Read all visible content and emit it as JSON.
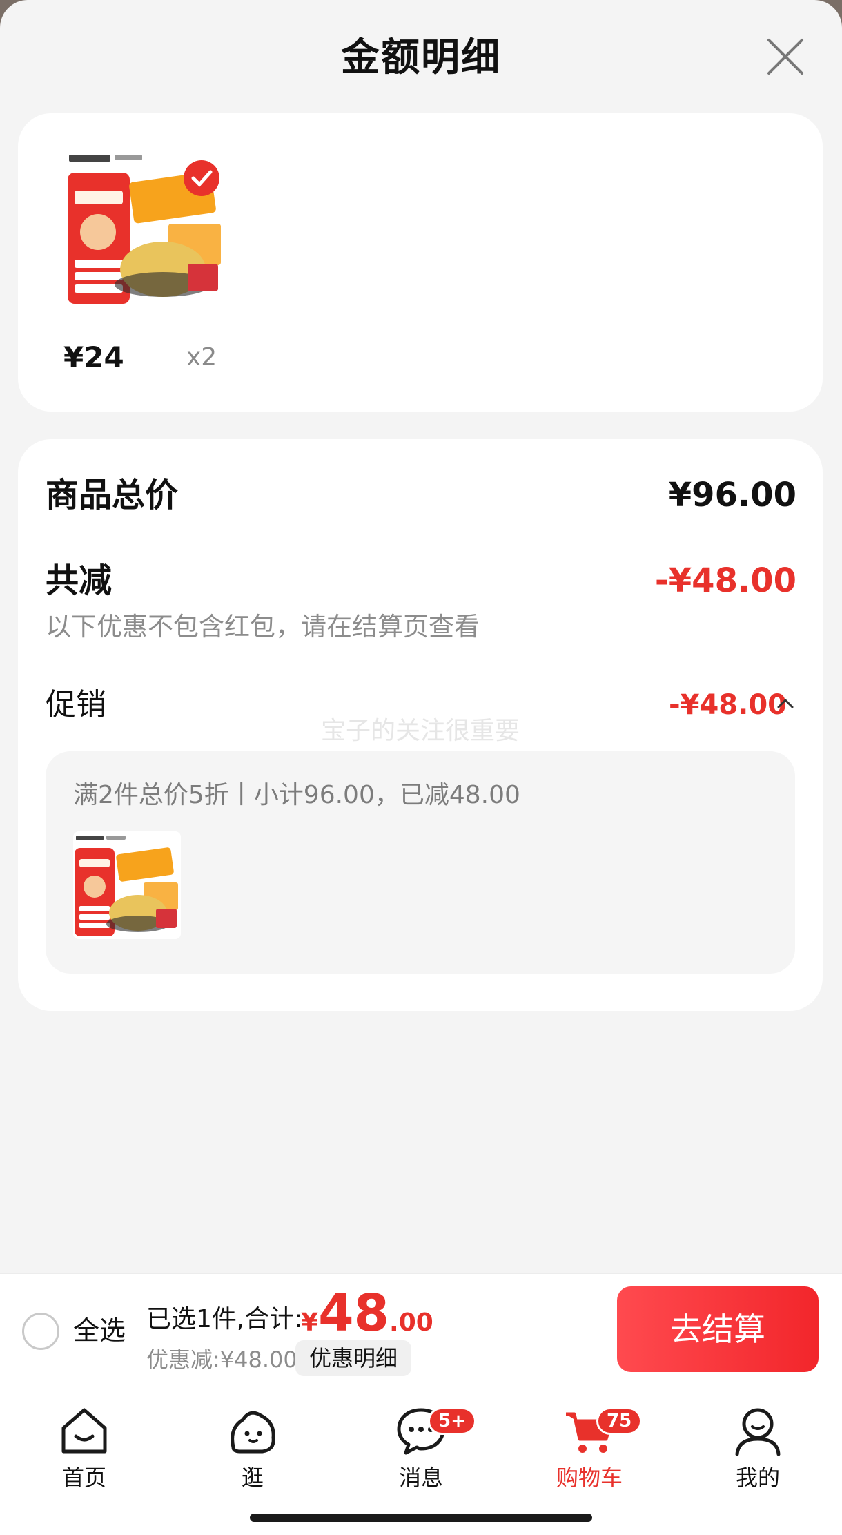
{
  "sheet": {
    "title": "金额明细"
  },
  "product": {
    "unit_price": "¥24",
    "quantity": "x2"
  },
  "summary": {
    "total_label": "商品总价",
    "total_value": "¥96.00",
    "reduced_label": "共减",
    "reduced_value": "-¥48.00",
    "note": "以下优惠不包含红包，请在结算页查看",
    "promo_label": "促销",
    "promo_value": "-¥48.00",
    "watermark": "宝子的关注很重要",
    "promo_desc": "满2件总价5折丨小计96.00，已减48.00"
  },
  "checkout": {
    "select_all": "全选",
    "selected_text": "已选1件,合计:",
    "currency": "¥",
    "total_int": "48",
    "total_dec": ".00",
    "discount_text": "优惠减:¥48.00",
    "detail_button": "优惠明细",
    "checkout_button": "去结算"
  },
  "tabbar": {
    "items": [
      {
        "label": "首页",
        "icon": "home-icon"
      },
      {
        "label": "逛",
        "icon": "browse-icon"
      },
      {
        "label": "消息",
        "icon": "message-icon",
        "badge": "5+"
      },
      {
        "label": "购物车",
        "icon": "cart-icon",
        "badge": "75",
        "active": true
      },
      {
        "label": "我的",
        "icon": "profile-icon"
      }
    ]
  },
  "colors": {
    "accent_red": "#e8312b",
    "background": "#f4f4f4",
    "card": "#ffffff"
  }
}
